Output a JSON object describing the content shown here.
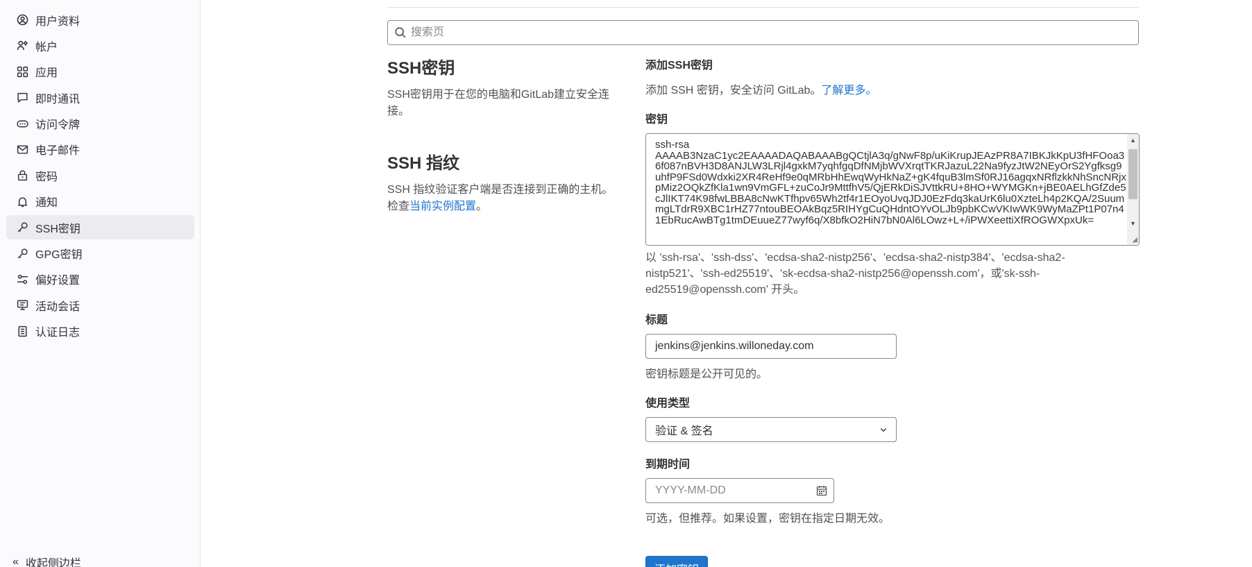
{
  "sidebar": {
    "items": [
      {
        "label": "用户资料",
        "icon": "user-icon"
      },
      {
        "label": "帐户",
        "icon": "account-icon"
      },
      {
        "label": "应用",
        "icon": "applications-icon"
      },
      {
        "label": "即时通讯",
        "icon": "comment-icon"
      },
      {
        "label": "访问令牌",
        "icon": "token-icon"
      },
      {
        "label": "电子邮件",
        "icon": "mail-icon"
      },
      {
        "label": "密码",
        "icon": "lock-icon"
      },
      {
        "label": "通知",
        "icon": "notifications-icon"
      },
      {
        "label": "SSH密钥",
        "icon": "key-icon",
        "active": true
      },
      {
        "label": "GPG密钥",
        "icon": "key-icon"
      },
      {
        "label": "偏好设置",
        "icon": "preferences-icon"
      },
      {
        "label": "活动会话",
        "icon": "monitor-icon"
      },
      {
        "label": "认证日志",
        "icon": "log-icon"
      }
    ],
    "collapse_label": "收起侧边栏"
  },
  "search": {
    "placeholder": "搜索页"
  },
  "left": {
    "ssh_title": "SSH密钥",
    "ssh_desc": "SSH密钥用于在您的电脑和GitLab建立安全连接。",
    "fp_title": "SSH 指纹",
    "fp_desc_prefix": "SSH 指纹验证客户端是否连接到正确的主机。检查",
    "fp_link": "当前实例配置",
    "fp_desc_suffix": "。"
  },
  "form": {
    "add_title": "添加SSH密钥",
    "add_desc": "添加 SSH 密钥，安全访问 GitLab。",
    "learn_more": "了解更多。",
    "key_label": "密钥",
    "key_value": "ssh-rsa\nAAAAB3NzaC1yc2EAAAADAQABAAABgQCtjlA3q/gNwF8p/uKiKrupJEAzPR8A7IBKJkKpU3fHFOoa36f087nBVH3D8ANJLW3LRjl4gxkM7yqhfgqDfNMjbWVXrqtTKRJazuL22Na9fyzJtW2NEyOrS2Ygfksg9uhfP9FSd0Wdxki2XR4ReHf9e0qMRbHhEwqWyHkNaZ+gK4fquB3lmSf0RJ16agqxNRflzkkNhSncNRjxpMiz2OQkZfKla1wn9VmGFL+zuCoJr9MttfhV5/QjERkDiSJVttkRU+8HO+WYMGKn+jBE0AELhGfZde5cJlIKT74K98fwLBBA8cNwKTfhpv65Wh2tf4r1EOyoUvqJDJ0EzFdq3kaUrK6lu0XzteLh4p2KQA/2SuummgLTdrR9XBC1rHZ77ntouBEOAkBqz5RIHYgCuQHdntOYvOLJb9pbKCwVKIwWK9WyMaZPt1P07n41EbRucAwBTg1tmDEuueZ77wyf6q/X8bfkO2HiN7bN0Al6LOwz+L+/iPWXeettiXfROGWXpxUk=",
    "key_help": "以 'ssh-rsa'、'ssh-dss'、'ecdsa-sha2-nistp256'、'ecdsa-sha2-nistp384'、'ecdsa-sha2-nistp521'、'ssh-ed25519'、'sk-ecdsa-sha2-nistp256@openssh.com'，或'sk-ssh-ed25519@openssh.com' 开头。",
    "title_label": "标题",
    "title_value": "jenkins@jenkins.willoneday.com",
    "title_help": "密钥标题是公开可见的。",
    "usage_label": "使用类型",
    "usage_value": "验证 & 签名",
    "expiry_label": "到期时间",
    "expiry_placeholder": "YYYY-MM-DD",
    "expiry_help": "可选，但推荐。如果设置，密钥在指定日期无效。",
    "submit_label": "添加密钥"
  },
  "colors": {
    "accent": "#1f75cb",
    "active_bg": "#ececef",
    "sidebar_bg": "#fbfafd"
  }
}
